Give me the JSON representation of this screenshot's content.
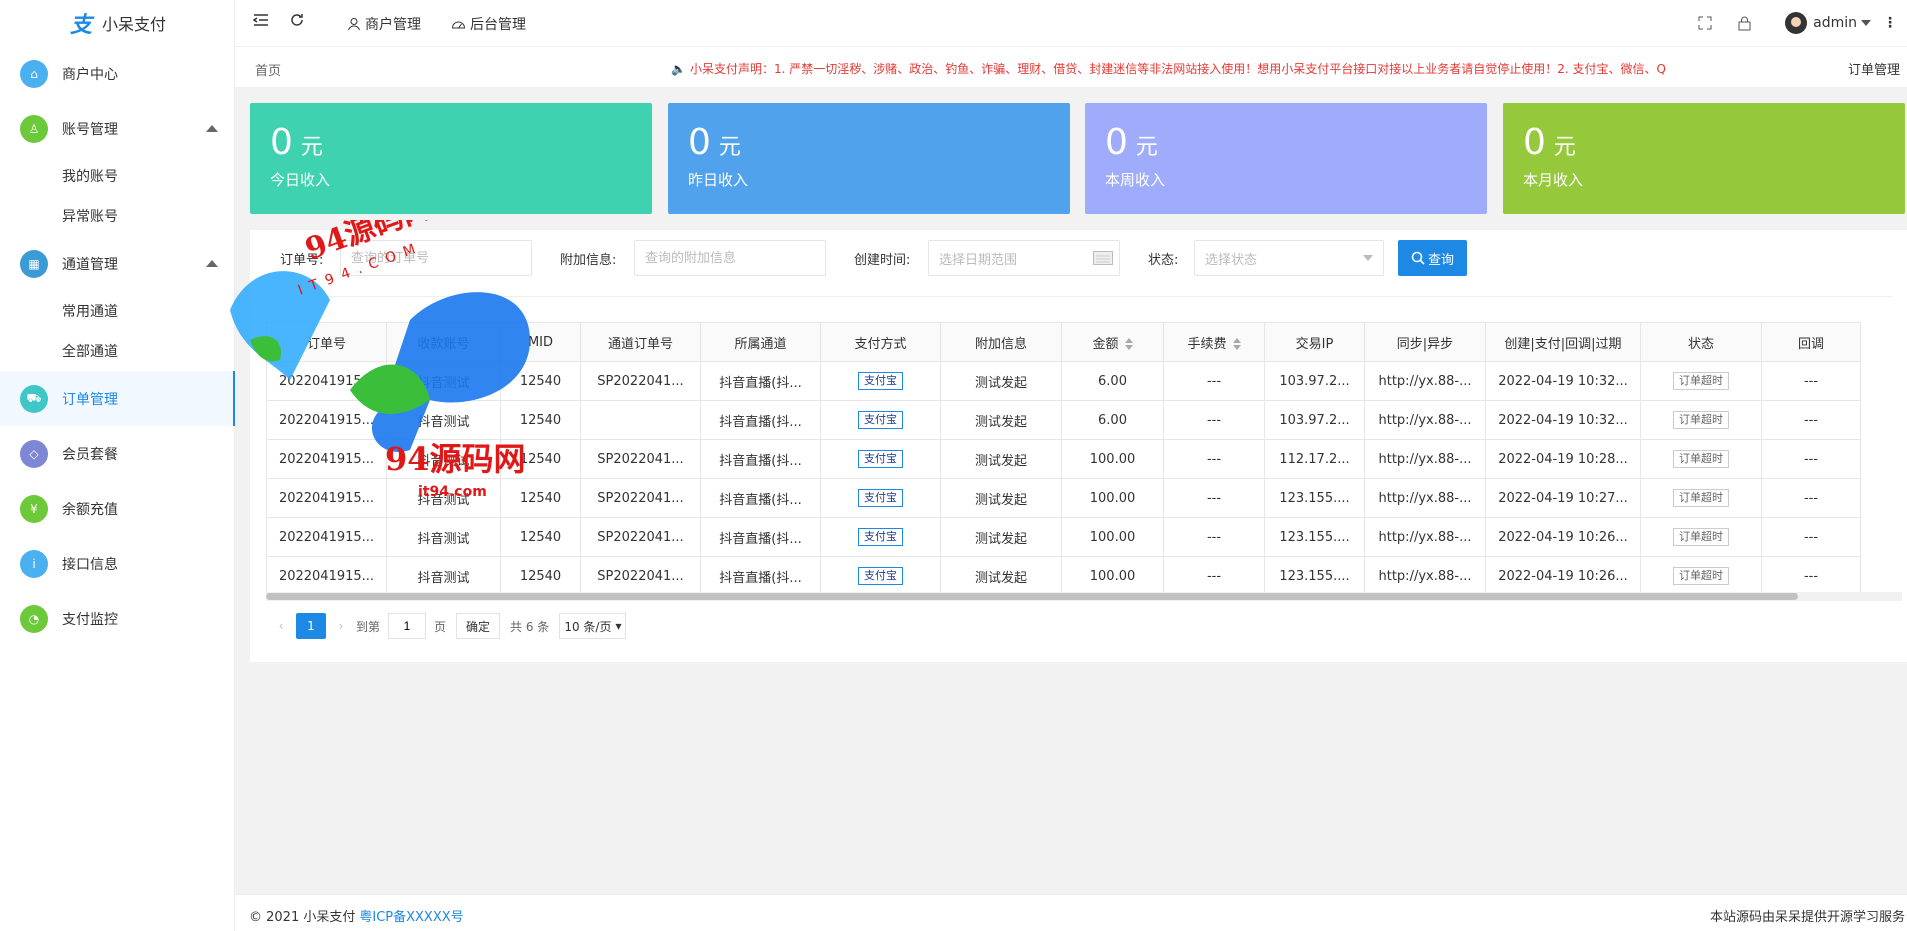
{
  "app": {
    "name": "小呆支付",
    "logo_glyph": "支"
  },
  "colors": {
    "accent": "#1e88e5",
    "card1": "#3fd2b0",
    "card2": "#51a2ec",
    "card3": "#9fabfb",
    "card4": "#96c83c"
  },
  "sidebar": {
    "items": [
      {
        "label": "商户中心",
        "icon": "home-icon",
        "color": "#4ab0f0"
      },
      {
        "label": "账号管理",
        "icon": "user-icon",
        "color": "#6cc93a",
        "expanded": true,
        "children": [
          {
            "label": "我的账号"
          },
          {
            "label": "异常账号"
          }
        ]
      },
      {
        "label": "通道管理",
        "icon": "grid-icon",
        "color": "#3a9bd6",
        "expanded": true,
        "children": [
          {
            "label": "常用通道"
          },
          {
            "label": "全部通道"
          }
        ]
      },
      {
        "label": "订单管理",
        "icon": "cart-icon",
        "color": "#3fc7c7",
        "active": true
      },
      {
        "label": "会员套餐",
        "icon": "diamond-icon",
        "color": "#7e86d6"
      },
      {
        "label": "余额充值",
        "icon": "coin-icon",
        "color": "#6cc93a"
      },
      {
        "label": "接口信息",
        "icon": "info-icon",
        "color": "#4ab0f0"
      },
      {
        "label": "支付监控",
        "icon": "gauge-icon",
        "color": "#6cc93a"
      }
    ]
  },
  "header": {
    "menu_icon": "menu-fold-icon",
    "refresh_icon": "refresh-icon",
    "merchant_label": "商户管理",
    "admin_label": "后台管理",
    "user_name": "admin"
  },
  "breadcrumb": {
    "home": "首页",
    "notice": "小呆支付声明：1. 严禁一切淫秽、涉赌、政治、钓鱼、诈骗、理财、借贷、封建迷信等非法网站接入使用！想用小呆支付平台接口对接以上业务者请自觉停止使用！2. 支付宝、微信、Q",
    "right_label": "订单管理"
  },
  "stats": [
    {
      "value": "0",
      "unit": "元",
      "label": "今日收入"
    },
    {
      "value": "0",
      "unit": "元",
      "label": "昨日收入"
    },
    {
      "value": "0",
      "unit": "元",
      "label": "本周收入"
    },
    {
      "value": "0",
      "unit": "元",
      "label": "本月收入"
    }
  ],
  "filters": {
    "order_label": "订单号:",
    "order_placeholder": "查询的订单号",
    "extra_label": "附加信息:",
    "extra_placeholder": "查询的附加信息",
    "time_label": "创建时间:",
    "time_placeholder": "选择日期范围",
    "status_label": "状态:",
    "status_placeholder": "选择状态",
    "query_button": "查询"
  },
  "table": {
    "columns": [
      "订单号",
      "收款账号",
      "MID",
      "通道订单号",
      "所属通道",
      "支付方式",
      "附加信息",
      "金额",
      "手续费",
      "交易IP",
      "同步|异步",
      "创建|支付|回调|过期",
      "状态",
      "回调"
    ],
    "rows": [
      [
        "2022041915...",
        "抖音测试",
        "12540",
        "SP2022041...",
        "抖音直播(抖...",
        "支付宝",
        "测试发起",
        "6.00",
        "---",
        "103.97.2...",
        "http://yx.88-...",
        "2022-04-19 10:32...",
        "订单超时",
        "---"
      ],
      [
        "2022041915...",
        "抖音测试",
        "12540",
        "",
        "抖音直播(抖...",
        "支付宝",
        "测试发起",
        "6.00",
        "---",
        "103.97.2...",
        "http://yx.88-...",
        "2022-04-19 10:32...",
        "订单超时",
        "---"
      ],
      [
        "2022041915...",
        "抖音测试",
        "12540",
        "SP2022041...",
        "抖音直播(抖...",
        "支付宝",
        "测试发起",
        "100.00",
        "---",
        "112.17.2...",
        "http://yx.88-...",
        "2022-04-19 10:28...",
        "订单超时",
        "---"
      ],
      [
        "2022041915...",
        "抖音测试",
        "12540",
        "SP2022041...",
        "抖音直播(抖...",
        "支付宝",
        "测试发起",
        "100.00",
        "---",
        "123.155....",
        "http://yx.88-...",
        "2022-04-19 10:27...",
        "订单超时",
        "---"
      ],
      [
        "2022041915...",
        "抖音测试",
        "12540",
        "SP2022041...",
        "抖音直播(抖...",
        "支付宝",
        "测试发起",
        "100.00",
        "---",
        "123.155....",
        "http://yx.88-...",
        "2022-04-19 10:26...",
        "订单超时",
        "---"
      ],
      [
        "2022041915...",
        "抖音测试",
        "12540",
        "SP2022041...",
        "抖音直播(抖...",
        "支付宝",
        "测试发起",
        "100.00",
        "---",
        "123.155....",
        "http://yx.88-...",
        "2022-04-19 10:26...",
        "订单超时",
        "---"
      ]
    ]
  },
  "pagination": {
    "current": "1",
    "goto_label": "到第",
    "page_input": "1",
    "page_suffix": "页",
    "confirm": "确定",
    "total": "共 6 条",
    "page_size": "10 条/页"
  },
  "footer": {
    "copyright": "© 2021 小呆支付",
    "icp": "粤ICP备XXXXX号",
    "right": "本站源码由呆呆提供开源学习服务"
  },
  "watermark": {
    "line1": "94源码网",
    "line2": "IT94.COM",
    "line3": "94源码网",
    "line4": "it94.com"
  }
}
